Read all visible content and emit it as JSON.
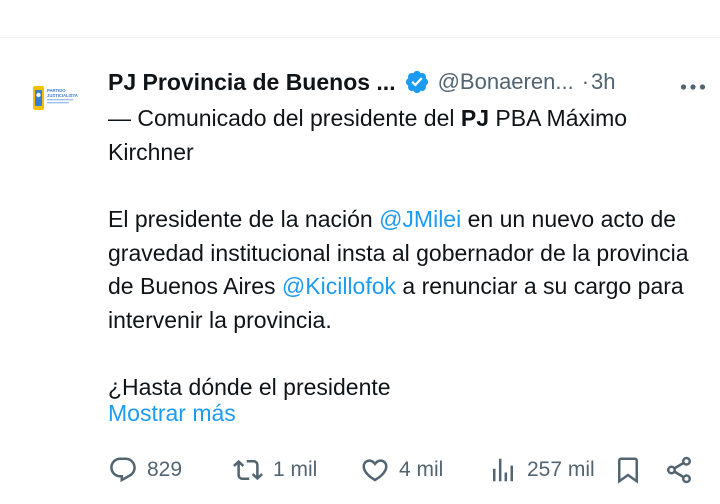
{
  "tweet": {
    "display_name": "PJ Provincia de Buenos ...",
    "handle": "@Bonaeren...",
    "separator": "·",
    "time": "3h",
    "body": {
      "line1_prefix": "— Comunicado del presidente del ",
      "line1_bold": "PJ",
      "line1_suffix": " PBA Máximo Kirchner",
      "p2_a": "El presidente de la nación ",
      "p2_mention1": "@JMilei",
      "p2_b": " en un nuevo acto de gravedad institucional insta al gobernador de la provincia de Buenos Aires ",
      "p2_mention2": "@Kicillofok",
      "p2_c": " a renunciar a su cargo para intervenir la provincia.",
      "p3": "¿Hasta dónde el presidente"
    },
    "show_more": "Mostrar más",
    "actions": {
      "replies": "829",
      "reposts": "1 mil",
      "likes": "4 mil",
      "views": "257 mil"
    },
    "avatar_text": {
      "line1": "PARTIDO",
      "line2": "JUSTICIALISTA"
    },
    "icons": {
      "verified": "verified-badge-icon",
      "more": "more-options-icon",
      "reply": "reply-icon",
      "repost": "repost-icon",
      "like": "like-icon",
      "views": "views-icon",
      "bookmark": "bookmark-icon",
      "share": "share-icon"
    },
    "colors": {
      "accent": "#1d9bf0",
      "secondary_text": "#536471",
      "primary_text": "#0f1419"
    }
  }
}
